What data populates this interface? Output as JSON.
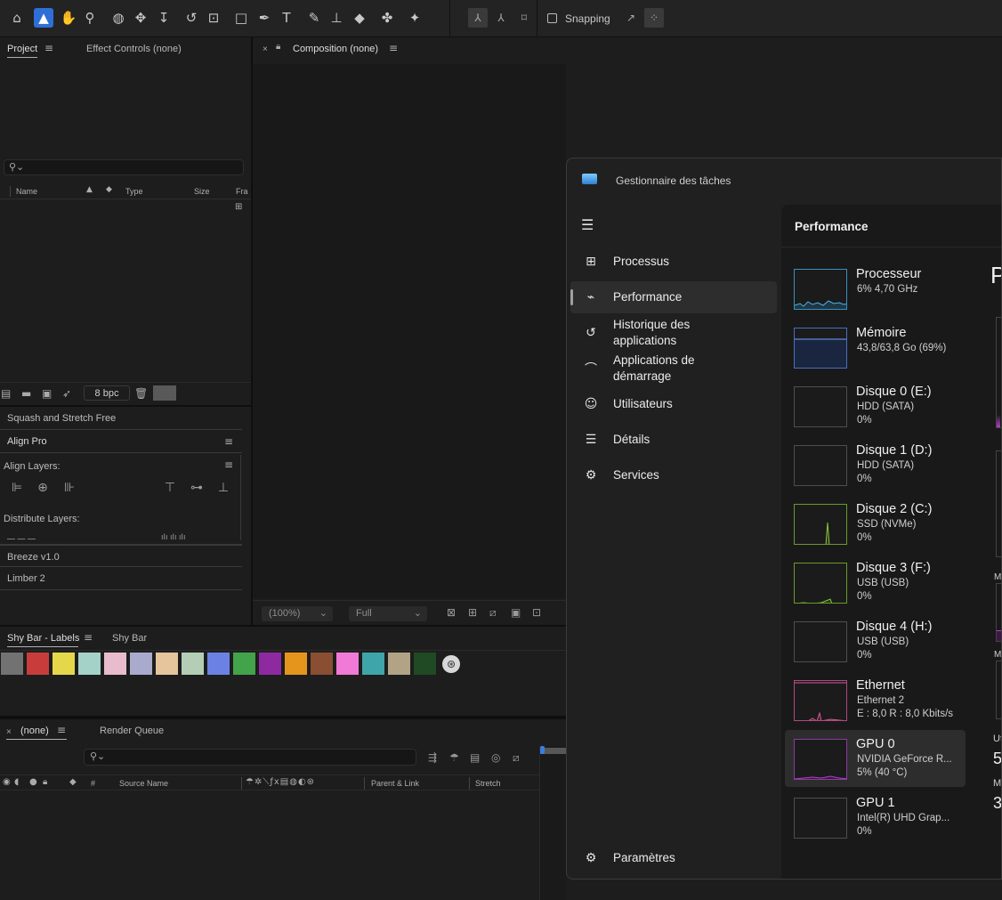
{
  "toolbar": {
    "snapping_label": "Snapping"
  },
  "project_panel": {
    "tabs": [
      "Project",
      "Effect Controls (none)"
    ],
    "columns": [
      "Name",
      "Type",
      "Size",
      "Fra"
    ],
    "bpc_label": "8 bpc"
  },
  "composition_panel": {
    "tab_label": "Composition (none)",
    "zoom_value": "(100%)",
    "resolution_value": "Full"
  },
  "scripts_panel": {
    "squash_label": "Squash and Stretch Free",
    "align_pro_title": "Align Pro",
    "align_layers_label": "Align Layers:",
    "distribute_layers_label": "Distribute Layers:",
    "breeze_label": "Breeze v1.0",
    "limber_label": "Limber 2"
  },
  "shy_bar": {
    "tabs": [
      "Shy Bar - Labels",
      "Shy Bar"
    ],
    "colors": [
      "#727272",
      "#c83c3c",
      "#e4d84a",
      "#a5d2c8",
      "#e8bccd",
      "#aaaacc",
      "#e6c49c",
      "#b4ceb6",
      "#6b82e4",
      "#43a34a",
      "#8e2aa0",
      "#e5951c",
      "#8a4e32",
      "#f07ad6",
      "#3ea6a8",
      "#b3a386",
      "#1f4a23"
    ]
  },
  "timeline": {
    "tab_label": "(none)",
    "render_queue_label": "Render Queue",
    "columns": {
      "hash": "#",
      "source_name": "Source Name",
      "parent": "Parent & Link",
      "stretch": "Stretch"
    }
  },
  "task_manager": {
    "title": "Gestionnaire des tâches",
    "nav": [
      {
        "icon": "processes-icon",
        "label": "Processus"
      },
      {
        "icon": "performance-icon",
        "label": "Performance"
      },
      {
        "icon": "history-icon",
        "label": "Historique des applications"
      },
      {
        "icon": "startup-icon",
        "label": "Applications de démarrage"
      },
      {
        "icon": "users-icon",
        "label": "Utilisateurs"
      },
      {
        "icon": "details-icon",
        "label": "Détails"
      },
      {
        "icon": "services-icon",
        "label": "Services"
      }
    ],
    "settings_label": "Paramètres",
    "section_title": "Performance",
    "right_heading": "P",
    "right_labels": [
      "M",
      "M",
      "Ut",
      "5",
      "M",
      "3"
    ],
    "devices": [
      {
        "name": "Processeur",
        "sub1": "6% 4,70 GHz",
        "sub2": ""
      },
      {
        "name": "Mémoire",
        "sub1": "43,8/63,8 Go (69%)",
        "sub2": ""
      },
      {
        "name": "Disque 0 (E:)",
        "sub1": "HDD (SATA)",
        "sub2": "0%"
      },
      {
        "name": "Disque 1 (D:)",
        "sub1": "HDD (SATA)",
        "sub2": "0%"
      },
      {
        "name": "Disque 2 (C:)",
        "sub1": "SSD (NVMe)",
        "sub2": "0%"
      },
      {
        "name": "Disque 3 (F:)",
        "sub1": "USB (USB)",
        "sub2": "0%"
      },
      {
        "name": "Disque 4 (H:)",
        "sub1": "USB (USB)",
        "sub2": "0%"
      },
      {
        "name": "Ethernet",
        "sub1": "Ethernet 2",
        "sub2": "E : 8,0 R : 8,0 Kbits/s"
      },
      {
        "name": "GPU 0",
        "sub1": "NVIDIA GeForce R...",
        "sub2": "5% (40 °C)"
      },
      {
        "name": "GPU 1",
        "sub1": "Intel(R) UHD Grap...",
        "sub2": "0%"
      }
    ]
  }
}
